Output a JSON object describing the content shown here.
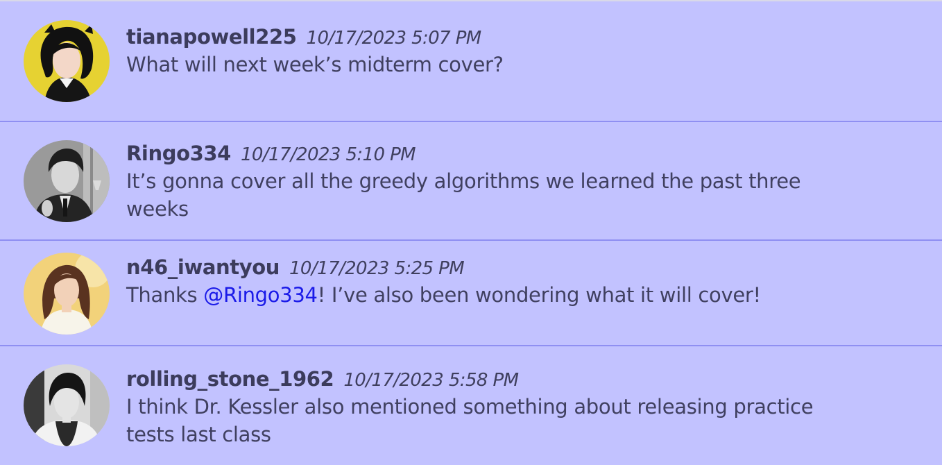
{
  "thread": {
    "messages": [
      {
        "username": "tianapowell225",
        "timestamp": "10/17/2023 5:07 PM",
        "text": "What will next week’s midterm cover?",
        "avatar": {
          "icon": "user-avatar-icon",
          "background": "#e6d232",
          "hair": "#111111",
          "skin": "#f3d7c8",
          "clothes": "#151515"
        }
      },
      {
        "username": "Ringo334",
        "timestamp": "10/17/2023 5:10 PM",
        "text_line1": "It’s gonna cover all the greedy algorithms we learned the past three",
        "text_line2": "weeks",
        "avatar": {
          "icon": "user-avatar-icon",
          "background": "#9a9a9a",
          "hair": "#1e1e1e",
          "skin": "#d8d8d8",
          "clothes": "#242424"
        }
      },
      {
        "username": "n46_iwantyou",
        "timestamp": "10/17/2023 5:25 PM",
        "text_before": "Thanks ",
        "mention": "@Ringo334",
        "text_after": "! I’ve also been wondering what it will cover!",
        "avatar": {
          "icon": "user-avatar-icon",
          "background": "#f2d27a",
          "hair": "#5a3320",
          "skin": "#f2d1b8",
          "clothes": "#f7f4ea"
        }
      },
      {
        "username": "rolling_stone_1962",
        "timestamp": "10/17/2023 5:58 PM",
        "text_line1": "I think Dr. Kessler also mentioned something about releasing practice",
        "text_line2": "tests last class",
        "avatar": {
          "icon": "user-avatar-icon",
          "background": "#d9d9d9",
          "hair": "#151515",
          "skin": "#e4e4e4",
          "clothes": "#2a2a2a"
        }
      }
    ]
  },
  "colors": {
    "background": "#c2c2ff",
    "divider": "#8f8ff2",
    "username": "#3c3c5c",
    "text": "#404060",
    "mention": "#1a1ae8"
  }
}
